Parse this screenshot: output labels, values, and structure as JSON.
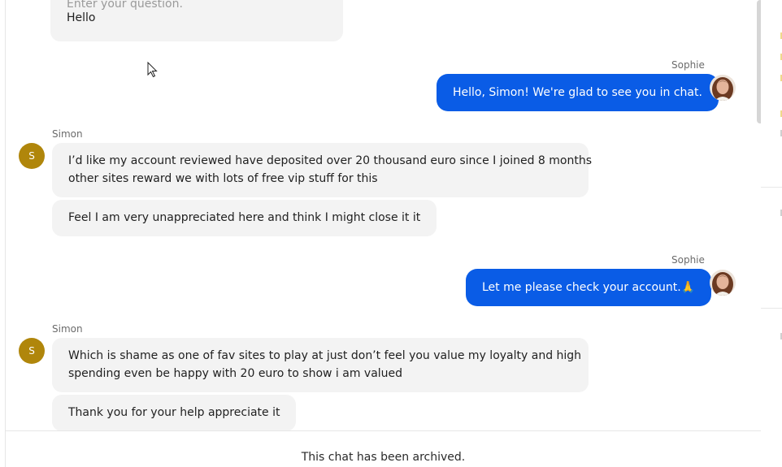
{
  "messages": {
    "first": {
      "placeholder": "Enter your question.",
      "text": "Hello"
    },
    "sophie_1": {
      "sender": "Sophie",
      "text": "Hello, Simon! We're glad to see you in chat."
    },
    "simon_1": {
      "sender": "Simon",
      "avatar_initial": "S",
      "line1": "I’d like my account reviewed have deposited over 20 thousand euro since I joined 8 months",
      "line2": "other sites reward we with lots of free vip stuff for this",
      "second": "Feel I am very unappreciated here and think I might close it it"
    },
    "sophie_2": {
      "sender": "Sophie",
      "text": "Let me please check your account.🙏"
    },
    "simon_2": {
      "sender": "Simon",
      "avatar_initial": "S",
      "line1": "Which is shame as one of fav sites to play at just don’t feel you value my loyalty and high",
      "line2": "spending even be happy with 20 euro to show i am valued",
      "second": "Thank you for your help appreciate it"
    }
  },
  "footer": {
    "archived_text": "This chat has been archived."
  },
  "colors": {
    "agent_bubble": "#0a5ce6",
    "visitor_bubble": "#f3f3f3",
    "visitor_avatar": "#b0860b"
  }
}
